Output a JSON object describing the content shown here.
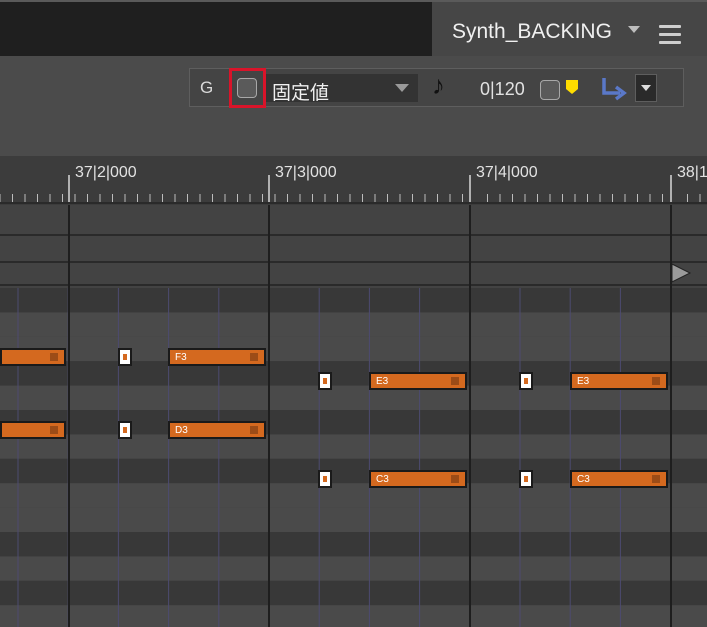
{
  "track": {
    "name": "Synth_BACKING"
  },
  "toolbar": {
    "grid_label": "G",
    "velocity_value": "固定値",
    "length_value": "0|120"
  },
  "ruler": {
    "labels": [
      "37|2|000",
      "37|3|000",
      "37|4|000",
      "38|1"
    ]
  },
  "notes": [
    {
      "label": "",
      "row": 1,
      "start": 0,
      "end": 66
    },
    {
      "label": "F3",
      "row": 1,
      "start": 168,
      "end": 266
    },
    {
      "label": "E3",
      "row": 2,
      "start": 369,
      "end": 467
    },
    {
      "label": "E3",
      "row": 2,
      "start": 570,
      "end": 668
    },
    {
      "label": "",
      "row": 4,
      "start": 0,
      "end": 66
    },
    {
      "label": "D3",
      "row": 4,
      "start": 168,
      "end": 266
    },
    {
      "label": "C3",
      "row": 6,
      "start": 369,
      "end": 467
    },
    {
      "label": "C3",
      "row": 6,
      "start": 570,
      "end": 668
    }
  ],
  "colors": {
    "note": "#d4691f",
    "highlight": "#d9142a",
    "marker": "#ffdd00",
    "arrow": "#5a78c8"
  }
}
